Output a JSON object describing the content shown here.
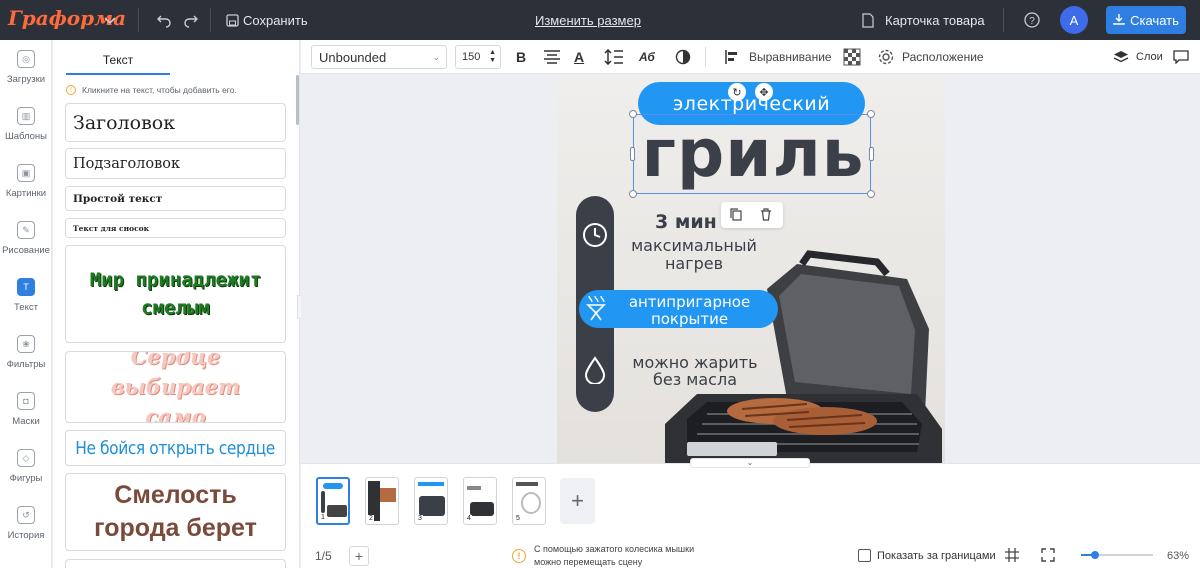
{
  "app": {
    "logo": "Граформа"
  },
  "topbar": {
    "save_label": "Сохранить",
    "resize_label": "Изменить размер",
    "doc_title": "Карточка товара",
    "avatar_letter": "А",
    "download_label": "Скачать"
  },
  "leftnav": {
    "items": [
      {
        "label": "Загрузки",
        "icon": "upload-icon"
      },
      {
        "label": "Шаблоны",
        "icon": "templates-icon"
      },
      {
        "label": "Картинки",
        "icon": "image-icon"
      },
      {
        "label": "Рисование",
        "icon": "draw-icon"
      },
      {
        "label": "Текст",
        "icon": "text-icon"
      },
      {
        "label": "Фильтры",
        "icon": "filter-icon"
      },
      {
        "label": "Маски",
        "icon": "mask-icon"
      },
      {
        "label": "Фигуры",
        "icon": "shapes-icon"
      },
      {
        "label": "История",
        "icon": "history-icon"
      }
    ]
  },
  "panel": {
    "tab": "Текст",
    "hint": "Кликните на текст, чтобы добавить его.",
    "presets": [
      "Заголовок",
      "Подзаголовок",
      "Простой текст",
      "Текст для сносок"
    ],
    "styled": [
      "Мир принадлежит смелым",
      "Сердце выбирает само",
      "Не бойся открыть сердце",
      "Смелость города берет"
    ]
  },
  "toolbar": {
    "font": "Unbounded",
    "size": "150",
    "align_label": "Выравнивание",
    "arrange_label": "Расположение",
    "layers_label": "Слои"
  },
  "design": {
    "badge_top": "электрический",
    "title": "гриль",
    "feature1_a": "3 мин",
    "feature1_b": "максимальный",
    "feature1_c": "нагрев",
    "feature2_a": "антипригарное",
    "feature2_b": "покрытие",
    "feature3_a": "можно жарить",
    "feature3_b": "без масла"
  },
  "pages": {
    "indicator": "1/5",
    "thumbs": [
      "1",
      "2",
      "3",
      "4",
      "5"
    ]
  },
  "statusbar": {
    "tip_line1": "С помощью зажатого колесика мышки",
    "tip_line2": "можно перемещать сцену",
    "show_outside": "Показать за границами",
    "zoom": "63%",
    "zoom_fraction": 0.2
  },
  "colors": {
    "accent": "#2f7fe3",
    "pill": "#2196f3",
    "dark": "#3b3f47"
  }
}
